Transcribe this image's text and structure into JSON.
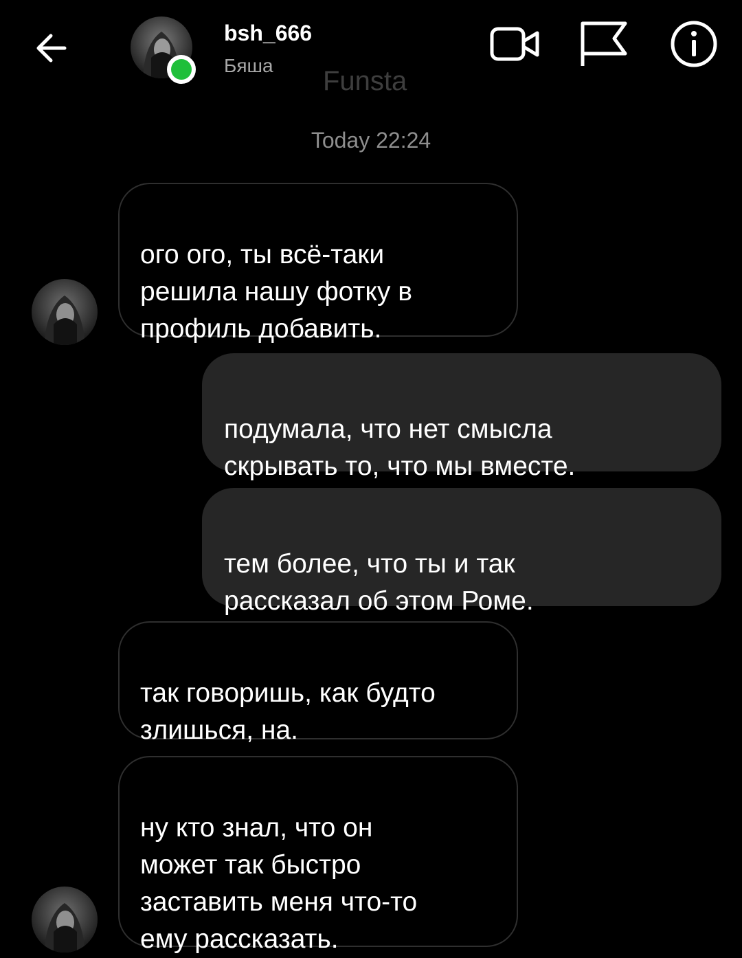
{
  "header": {
    "username": "bsh_666",
    "fullname": "Бяша",
    "watermark": "Funsta",
    "online": true,
    "icons": [
      "back-arrow-icon",
      "video-call-icon",
      "flag-icon",
      "info-icon"
    ]
  },
  "chat": {
    "timestamp": "Today 22:24",
    "messages": [
      {
        "direction": "incoming",
        "text": "ого ого, ты всё-таки\nрешила нашу фотку в\nпрофиль добавить."
      },
      {
        "direction": "outgoing",
        "text": "подумала, что нет смысла\nскрывать то, что мы вместе."
      },
      {
        "direction": "outgoing",
        "text": "тем более, что ты и так\nрассказал об этом Роме."
      },
      {
        "direction": "incoming",
        "text": "так говоришь, как будто\nзлишься, на."
      },
      {
        "direction": "incoming",
        "text": "ну кто знал, что он\nможет так быстро\nзаставить меня что-то\nему рассказать."
      }
    ]
  },
  "colors": {
    "background": "#000000",
    "outgoing_bubble": "#262626",
    "incoming_border": "#2f2f2f",
    "online": "#1fbf3a",
    "timestamp": "#8e8e8e",
    "watermark": "#3e3e3e"
  }
}
